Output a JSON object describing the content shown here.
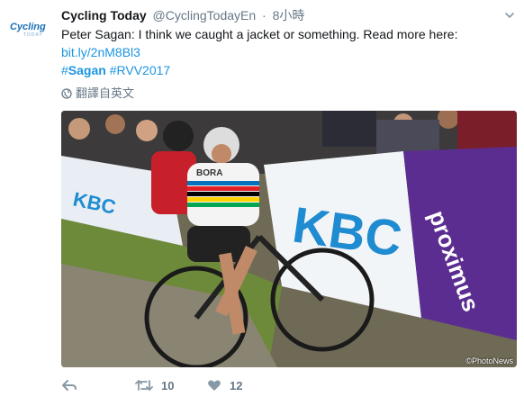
{
  "tweet": {
    "author_name": "Cycling Today",
    "author_handle": "@CyclingTodayEn",
    "separator": "·",
    "time": "8小時",
    "avatar_logo": "Cycling",
    "avatar_sub": "TODAY",
    "text_line1": "Peter Sagan: I think we caught a jacket or something. Read more here:",
    "link": "bit.ly/2nM8Bl3",
    "hashtags": [
      {
        "hash": "#",
        "tag": "Sagan",
        "bold": true
      },
      {
        "hash": "#",
        "tag": "RVV2017",
        "bold": false
      }
    ],
    "translate_label": "翻譯自英文",
    "media": {
      "watermark": "©PhotoNews",
      "banner_texts": [
        "KBC",
        "KBC",
        "proximus",
        "BORA"
      ]
    },
    "actions": {
      "reply_icon": "reply-icon",
      "retweet_icon": "retweet-icon",
      "retweet_count": "10",
      "like_icon": "heart-icon",
      "like_count": "12"
    }
  },
  "colors": {
    "link": "#1b95e0",
    "muted": "#657786",
    "text": "#14171a",
    "kbc_blue": "#1f8bd0",
    "proximus_purple": "#5c2d91"
  }
}
